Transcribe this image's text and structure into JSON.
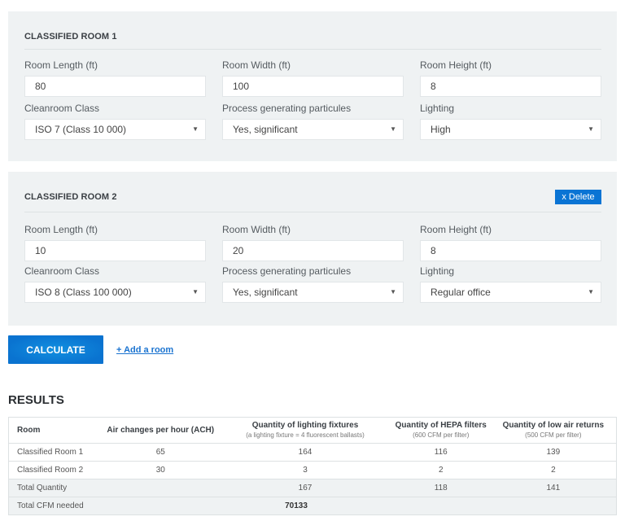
{
  "rooms": [
    {
      "title": "CLASSIFIED ROOM 1",
      "has_delete": false,
      "fields": {
        "length": {
          "label": "Room Length (ft)",
          "value": "80"
        },
        "width": {
          "label": "Room Width (ft)",
          "value": "100"
        },
        "height": {
          "label": "Room Height (ft)",
          "value": "8"
        },
        "class": {
          "label": "Cleanroom Class",
          "value": "ISO 7 (Class 10 000)"
        },
        "process": {
          "label": "Process generating particules",
          "value": "Yes, significant"
        },
        "lighting": {
          "label": "Lighting",
          "value": "High"
        }
      }
    },
    {
      "title": "CLASSIFIED ROOM 2",
      "has_delete": true,
      "delete_label": "x Delete",
      "fields": {
        "length": {
          "label": "Room Length (ft)",
          "value": "10"
        },
        "width": {
          "label": "Room Width (ft)",
          "value": "20"
        },
        "height": {
          "label": "Room Height (ft)",
          "value": "8"
        },
        "class": {
          "label": "Cleanroom Class",
          "value": "ISO 8 (Class 100 000)"
        },
        "process": {
          "label": "Process generating particules",
          "value": "Yes, significant"
        },
        "lighting": {
          "label": "Lighting",
          "value": "Regular office"
        }
      }
    }
  ],
  "icons": {
    "select_caret": "▼"
  },
  "actions": {
    "calculate_label": "CALCULATE",
    "add_room_label": "+ Add a room"
  },
  "results": {
    "title": "RESULTS",
    "headers": [
      {
        "label": "Room",
        "sub": ""
      },
      {
        "label": "Air changes per hour (ACH)",
        "sub": ""
      },
      {
        "label": "Quantity of lighting fixtures",
        "sub": "(a lighting fixture = 4 fluorescent ballasts)"
      },
      {
        "label": "Quantity of HEPA filters",
        "sub": "(600 CFM per filter)"
      },
      {
        "label": "Quantity of low air returns",
        "sub": "(500 CFM per filter)"
      }
    ],
    "rows": [
      {
        "room": "Classified Room 1",
        "ach": "65",
        "lighting": "164",
        "hepa": "116",
        "returns": "139"
      },
      {
        "room": "Classified Room 2",
        "ach": "30",
        "lighting": "3",
        "hepa": "2",
        "returns": "2"
      }
    ],
    "total_quantity": {
      "label": "Total Quantity",
      "ach": "",
      "lighting": "167",
      "hepa": "118",
      "returns": "141"
    },
    "total_cfm": {
      "label": "Total CFM needed",
      "value": "70133"
    }
  },
  "colors": {
    "accent": "#0a74d4",
    "panel_bg": "#eff2f3",
    "link": "#1a73d0"
  }
}
